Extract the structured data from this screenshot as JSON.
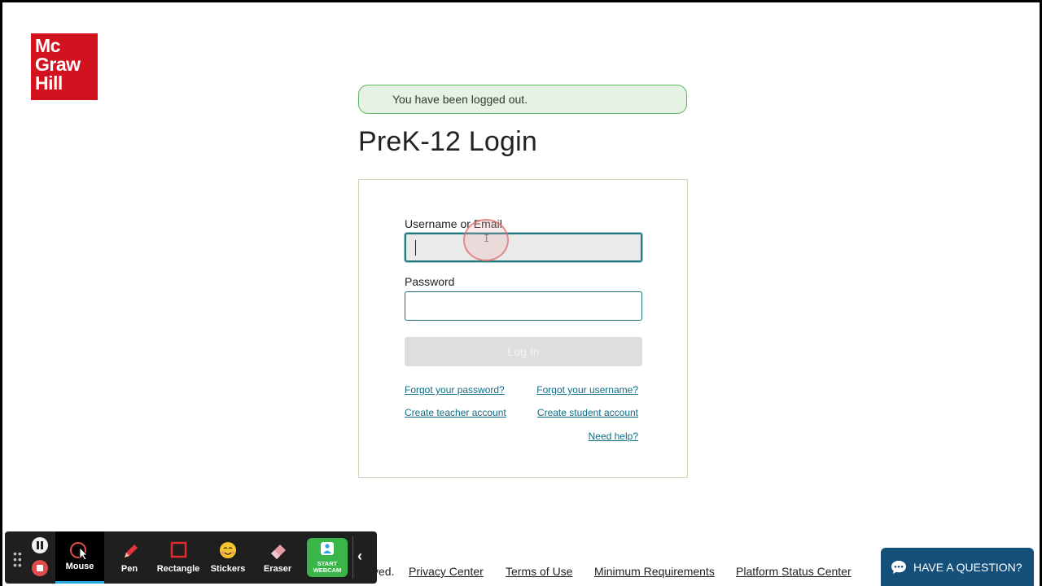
{
  "logo": {
    "line1": "Mc",
    "line2": "Graw",
    "line3": "Hill"
  },
  "alert": {
    "message": "You have been logged out."
  },
  "page_title": "PreK-12 Login",
  "form": {
    "username_label": "Username or Email",
    "username_value": "",
    "password_label": "Password",
    "password_value": "",
    "login_button": "Log In"
  },
  "links": {
    "forgot_password": "Forgot your password?",
    "forgot_username": "Forgot your username?",
    "create_teacher": "Create teacher account",
    "create_student": "Create student account",
    "need_help": "Need help?"
  },
  "footer": {
    "copyright_tail": "ved.",
    "privacy": "Privacy Center",
    "terms": "Terms of Use",
    "requirements": "Minimum Requirements",
    "status": "Platform Status Center"
  },
  "toolbar": {
    "tools": [
      {
        "label": "Mouse",
        "icon": "mouse-pointer-icon",
        "active": true
      },
      {
        "label": "Pen",
        "icon": "pen-icon",
        "active": false
      },
      {
        "label": "Rectangle",
        "icon": "rectangle-icon",
        "active": false
      },
      {
        "label": "Stickers",
        "icon": "sticker-icon",
        "active": false
      },
      {
        "label": "Eraser",
        "icon": "eraser-icon",
        "active": false
      }
    ],
    "webcam_line1": "START",
    "webcam_line2": "WEBCAM"
  },
  "chat": {
    "label": "HAVE A QUESTION?"
  },
  "colors": {
    "brand_red": "#d3121f",
    "alert_bg": "#e6f2e3",
    "alert_border": "#5cb85c",
    "link": "#0e6e86",
    "chat_bg": "#15507a",
    "webcam_green": "#3ab54a"
  }
}
